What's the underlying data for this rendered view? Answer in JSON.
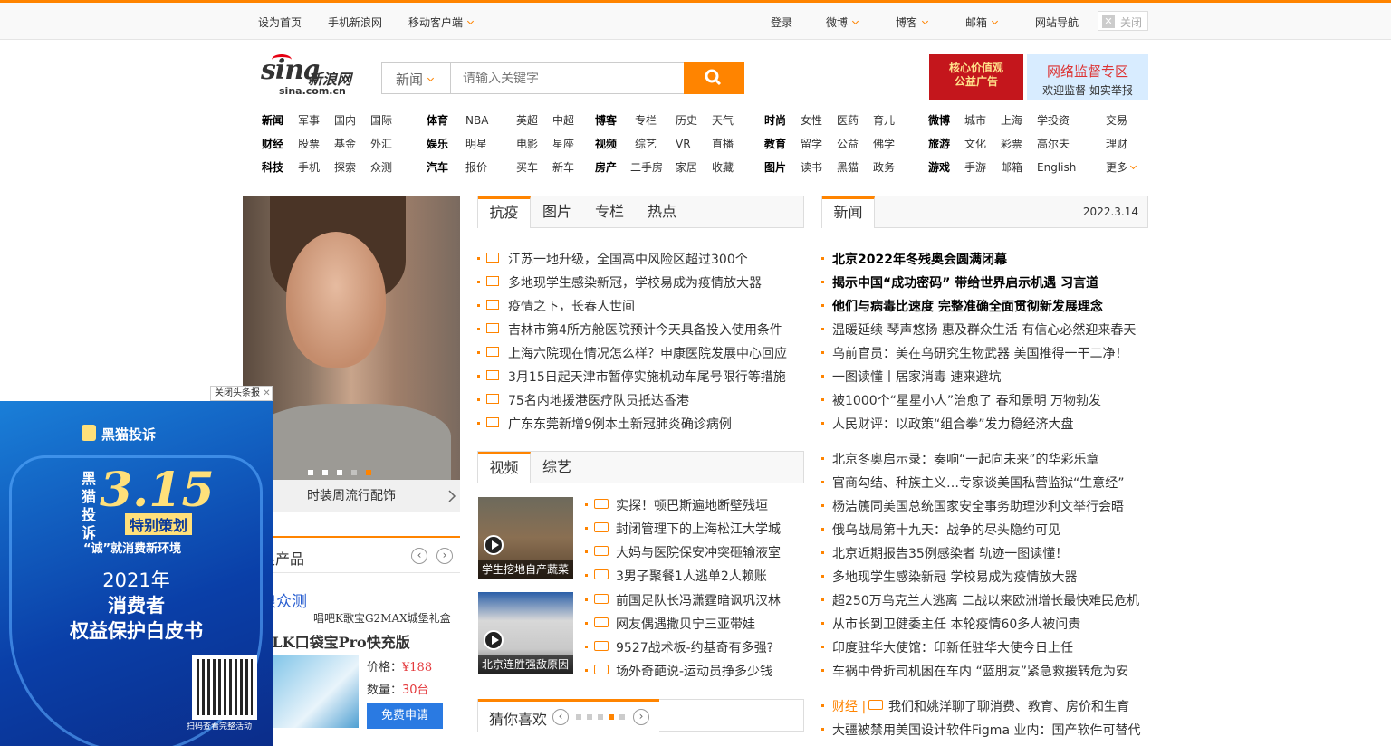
{
  "topbar": {
    "set_home": "设为首页",
    "mobile_sina": "手机新浪网",
    "mobile_client": "移动客户端",
    "login": "登录",
    "weibo": "微博",
    "blog": "博客",
    "mail": "邮箱",
    "site_nav": "网站导航",
    "close": "关闭"
  },
  "logo": {
    "text": "sina",
    "cn": "新浪网",
    "domain": "sina.com.cn"
  },
  "search": {
    "category": "新闻",
    "placeholder": "请输入关键字"
  },
  "banner": {
    "left": "核心价值观\n公益广告",
    "right_title": "网络监督专区",
    "right_sub": "欢迎监督 如实举报"
  },
  "nav": [
    {
      "rows": [
        [
          "新闻",
          "军事",
          "国内",
          "国际"
        ],
        [
          "财经",
          "股票",
          "基金",
          "外汇"
        ],
        [
          "科技",
          "手机",
          "探索",
          "众测"
        ]
      ]
    },
    {
      "rows": [
        [
          "体育",
          "NBA",
          "英超",
          "中超"
        ],
        [
          "娱乐",
          "明星",
          "电影",
          "星座"
        ],
        [
          "汽车",
          "报价",
          "买车",
          "新车"
        ]
      ]
    },
    {
      "rows": [
        [
          "博客",
          "专栏",
          "历史",
          "天气"
        ],
        [
          "视频",
          "综艺",
          "VR",
          "直播"
        ],
        [
          "房产",
          "二手房",
          "家居",
          "收藏"
        ]
      ]
    },
    {
      "rows": [
        [
          "时尚",
          "女性",
          "医药",
          "育儿"
        ],
        [
          "教育",
          "留学",
          "公益",
          "佛学"
        ],
        [
          "图片",
          "读书",
          "黑猫",
          "政务"
        ]
      ]
    },
    {
      "rows": [
        [
          "微博",
          "城市",
          "上海",
          "学投资"
        ],
        [
          "旅游",
          "文化",
          "彩票",
          "高尔夫"
        ],
        [
          "游戏",
          "手游",
          "邮箱",
          "English"
        ]
      ]
    },
    {
      "rows": [
        [
          "交易"
        ],
        [
          "理财"
        ],
        [
          "更多"
        ]
      ]
    }
  ],
  "slide": {
    "caption": "时装周流行配饰"
  },
  "tabs_main": [
    "抗疫",
    "图片",
    "专栏",
    "热点"
  ],
  "covid_list": [
    "江苏一地升级，全国高中风险区超过300个",
    "多地现学生感染新冠，学校易成为疫情放大器",
    "疫情之下，长春人世间",
    "吉林市第4所方舱医院预计今天具备投入使用条件",
    "上海六院现在情况怎么样？申康医院发展中心回应",
    "3月15日起天津市暂停实施机动车尾号限行等措施",
    "75名内地援港医疗队员抵达香港",
    "广东东莞新增9例本土新冠肺炎确诊病例"
  ],
  "tabs_video": [
    "视频",
    "综艺"
  ],
  "video_thumbs": [
    "学生挖地自产蔬菜",
    "北京连胜强敌原因"
  ],
  "video_list": [
    "实探！顿巴斯遍地断壁残垣",
    "封闭管理下的上海松江大学城",
    "大妈与医院保安冲突砸输液室",
    "3男子聚餐1人逃单2人赖账",
    "前国足队长冯潇霆暗讽巩汉林",
    "网友偶遇撒贝宁三亚带娃",
    "9527战术板-约基奇有多强?",
    "场外奇葩说-运动员挣多少钱"
  ],
  "guess": {
    "title": "猜你喜欢"
  },
  "news": {
    "tab": "新闻",
    "date": "2022.3.14",
    "bold": [
      "北京2022年冬残奥会圆满闭幕",
      "揭示中国“成功密码” 带给世界启示机遇 习言道",
      "他们与病毒比速度 完整准确全面贯彻新发展理念"
    ],
    "group1": [
      "温暖延续 琴声悠扬 惠及群众生活 有信心必然迎来春天",
      "乌前官员：美在乌研究生物武器 美国推得一干二净！",
      "一图读懂丨居家消毒 速来避坑",
      "被1000个“星星小人”治愈了 春和景明 万物勃发",
      "人民财评：以政策“组合拳”发力稳经济大盘"
    ],
    "group2": [
      "北京冬奥启示录：奏响“一起向未来”的华彩乐章",
      "官商勾结、种族主义…专家谈美国私营监狱“生意经”",
      "杨洁篪同美国总统国家安全事务助理沙利文举行会晤",
      "俄乌战局第十九天：战争的尽头隐约可见",
      "北京近期报告35例感染者 轨迹一图读懂！",
      "多地现学生感染新冠 学校易成为疫情放大器",
      "超250万乌克兰人逃离 二战以来欧洲增长最快难民危机",
      "从市长到卫健委主任 本轮疫情60多人被问责",
      "印度驻华大使馆：印新任驻华大使今日上任",
      "车祸中骨折司机困在车内 “蓝朋友”紧急救援转危为安"
    ],
    "finance_label": "财经 |",
    "finance_item": "我们和姚洋聊了聊消费、教育、房价和生育",
    "last_item": "大疆被禁用美国设计软件Figma 业内：国产软件可替代"
  },
  "products": {
    "title": "浪产品",
    "sub1": "浪众测",
    "sub2": "唱吧K歌宝G2MAX城堡礼盒",
    "name": "ALK口袋宝Pro快充版",
    "price_label": "价格：",
    "price": "¥188",
    "qty_label": "数量：",
    "qty": "30台",
    "apply": "免费申请"
  },
  "ad": {
    "close": "关闭头条报",
    "brand": "黑猫投诉",
    "vertical": "黑猫投诉",
    "big": "3.15",
    "tag": "特别策划",
    "sub": "“诚”就消费新环境",
    "t1": "2021年",
    "t2": "消费者",
    "t3": "权益保护白皮书",
    "qr_text": "扫码查看完整活动"
  },
  "colors": {
    "accent": "#ff8400",
    "link": "#333333",
    "price": "#e4393c",
    "button": "#2a7ae2"
  }
}
